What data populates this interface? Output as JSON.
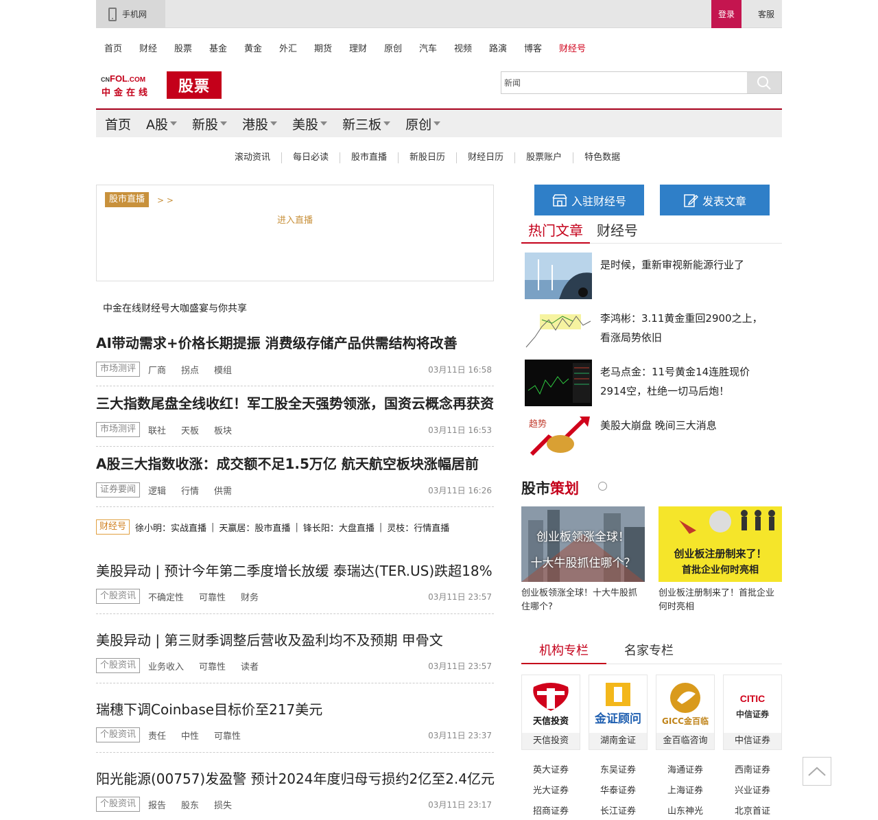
{
  "topbar": {
    "mobile": "手机网",
    "login": "登录",
    "service": "客服"
  },
  "channels": [
    "首页",
    "财经",
    "股票",
    "基金",
    "黄金",
    "外汇",
    "期货",
    "理财",
    "原创",
    "汽车",
    "视频",
    "路演",
    "博客",
    "财经号"
  ],
  "logo": {
    "cn": "CNFOL.COM",
    "zh": "中金在线",
    "section": "股票"
  },
  "search": {
    "value": "新闻"
  },
  "mainnav": [
    "首页",
    "A股",
    "新股",
    "港股",
    "美股",
    "新三板",
    "原创"
  ],
  "subnav": [
    "滚动资讯",
    "每日必读",
    "股市直播",
    "新股日历",
    "财经日历",
    "股票账户",
    "特色数据"
  ],
  "live": {
    "tag": "股市直播",
    "arrow": "> >",
    "enter": "进入直播"
  },
  "promo": "中金在线财经号大咖盛宴与你共享",
  "articles": [
    {
      "title": "AI带动需求+价格长期提振 消费级存储产品供需结构将改善",
      "tag": "市场测评",
      "keywords": [
        "厂商",
        "拐点",
        "模组"
      ],
      "time": "03月11日  16:58"
    },
    {
      "title": "三大指数尾盘全线收红！军工股全天强势领涨，国资云概念再获资",
      "tag": "市场测评",
      "keywords": [
        "联社",
        "天板",
        "板块"
      ],
      "time": "03月11日  16:53"
    },
    {
      "title": "A股三大指数收涨：成交额不足1.5万亿 航天航空板块涨幅居前",
      "tag": "证券要闻",
      "keywords": [
        "逻辑",
        "行情",
        "供需"
      ],
      "time": "03月11日  16:26"
    }
  ],
  "caijinghao": {
    "tag": "财经号",
    "items": [
      "徐小明：实战直播",
      "天赢居：股市直播",
      "锋长阳：大盘直播",
      "灵枝：行情直播"
    ]
  },
  "stock_articles": [
    {
      "title": "美股异动 | 预计今年第二季度增长放缓 泰瑞达(TER.US)跌超18%",
      "tag": "个股资讯",
      "keywords": [
        "不确定性",
        "可靠性",
        "财务"
      ],
      "time": "03月11日 23:57"
    },
    {
      "title": "美股异动 | 第三财季调整后营收及盈利均不及预期 甲骨文",
      "tag": "个股资讯",
      "keywords": [
        "业务收入",
        "可靠性",
        "读者"
      ],
      "time": "03月11日 23:57"
    },
    {
      "title": "瑞穗下调Coinbase目标价至217美元",
      "tag": "个股资讯",
      "keywords": [
        "责任",
        "中性",
        "可靠性"
      ],
      "time": "03月11日 23:37"
    },
    {
      "title": "阳光能源(00757)发盈警 预计2024年度归母亏损约2亿至2.4亿元",
      "tag": "个股资讯",
      "keywords": [
        "报告",
        "股东",
        "损失"
      ],
      "time": "03月11日 23:17"
    }
  ],
  "right": {
    "btn_join": "入驻财经号",
    "btn_post": "发表文章",
    "tabs": [
      "热门文章",
      "财经号"
    ],
    "hot": [
      "是时候，重新审视新能源行业了",
      "李鸿彬：3.11黄金重回2900之上，看涨局势依旧",
      "老马点金：11号黄金14连胜现价2914空，杜绝一切马后炮！",
      "美股大崩盘 晚间三大消息"
    ],
    "plan_title_a": "股市",
    "plan_title_b": "策划",
    "cards": [
      {
        "overlay1": "创业板领涨全球！",
        "overlay2": "十大牛股抓住哪个？",
        "caption": "创业板领涨全球！十大牛股抓住哪个?"
      },
      {
        "overlay1": "创业板注册制来了！",
        "overlay2": "首批企业何时亮相",
        "caption": "创业板注册制来了！首批企业何时亮相"
      }
    ],
    "col_tabs": [
      "机构专栏",
      "名家专栏"
    ],
    "orgs": [
      {
        "logo": "天信投资",
        "name": "天信投资"
      },
      {
        "logo": "金证顾问",
        "name": "湖南金证"
      },
      {
        "logo": "GICC金百临",
        "name": "金百临咨询"
      },
      {
        "logo": "中信证券",
        "name": "中信证券"
      }
    ],
    "brokers": [
      "英大证券",
      "东吴证券",
      "海通证券",
      "西南证券",
      "光大证券",
      "华泰证券",
      "上海证券",
      "兴业证券",
      "招商证券",
      "长江证券",
      "山东神光",
      "北京首证"
    ]
  },
  "colors": {
    "brand_red": "#c4001a",
    "login_bg": "#c4154f",
    "blue_btn": "#2f7fc8",
    "gold": "#c8913c"
  }
}
